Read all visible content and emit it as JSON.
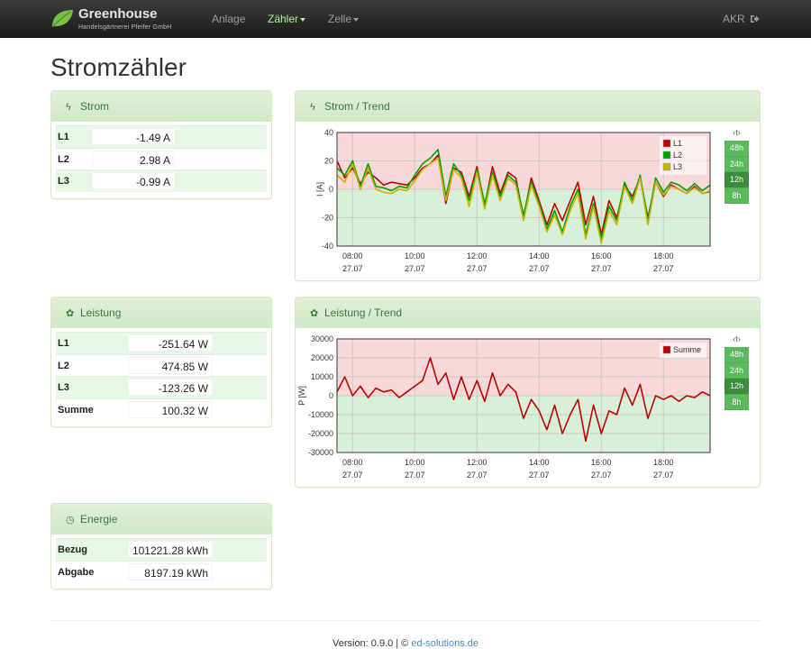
{
  "app": {
    "brand_title": "Greenhouse",
    "brand_subtitle": "Handelsgärtnerei Pfeifer GmbH",
    "brand_icon": "leaf-icon",
    "accent_color": "#5cb85c"
  },
  "nav": {
    "items": [
      {
        "label": "Anlage",
        "active": false
      },
      {
        "label": "Zähler",
        "active": true,
        "dropdown": true
      },
      {
        "label": "Zelle",
        "active": false,
        "dropdown": true
      }
    ],
    "user": "AKR",
    "logout_icon": "logout-icon"
  },
  "page": {
    "title": "Stromzähler"
  },
  "strom": {
    "title": "Strom",
    "icon": "bolt-icon",
    "rows": [
      {
        "label": "L1",
        "value": "-1.49 A"
      },
      {
        "label": "L2",
        "value": "2.98 A"
      },
      {
        "label": "L3",
        "value": "-0.99 A"
      }
    ]
  },
  "leistung": {
    "title": "Leistung",
    "icon": "gear-icon",
    "rows": [
      {
        "label": "L1",
        "value": "-251.64 W"
      },
      {
        "label": "L2",
        "value": "474.85 W"
      },
      {
        "label": "L3",
        "value": "-123.26 W"
      },
      {
        "label": "Summe",
        "value": "100.32 W"
      }
    ]
  },
  "energie": {
    "title": "Energie",
    "icon": "clock-icon",
    "rows": [
      {
        "label": "Bezug",
        "value": "101221.28 kWh"
      },
      {
        "label": "Abgabe",
        "value": "8197.19 kWh"
      }
    ]
  },
  "range": {
    "label": "‹t›",
    "options": [
      "48h",
      "24h",
      "12h",
      "8h"
    ],
    "active": "12h"
  },
  "strom_trend": {
    "title": "Strom / Trend",
    "icon": "bolt-icon",
    "chart_data": {
      "type": "line",
      "title": "",
      "ylabel": "I [A]",
      "ylim": [
        -40,
        40
      ],
      "yticks": [
        -40,
        -20,
        0,
        20,
        40
      ],
      "xlim": [
        7.5,
        19.5
      ],
      "xticks": [
        {
          "x": 8,
          "line1": "08:00",
          "line2": "27.07"
        },
        {
          "x": 10,
          "line1": "10:00",
          "line2": "27.07"
        },
        {
          "x": 12,
          "line1": "12:00",
          "line2": "27.07"
        },
        {
          "x": 14,
          "line1": "14:00",
          "line2": "27.07"
        },
        {
          "x": 16,
          "line1": "16:00",
          "line2": "27.07"
        },
        {
          "x": 18,
          "line1": "18:00",
          "line2": "27.07"
        }
      ],
      "positive_band_color": "#f8d8d8",
      "negative_band_color": "#d8f0d8",
      "legend_position": "top-right",
      "x": [
        7.5,
        7.75,
        8,
        8.25,
        8.5,
        8.75,
        9,
        9.25,
        9.5,
        9.75,
        10,
        10.25,
        10.5,
        10.75,
        11,
        11.25,
        11.5,
        11.75,
        12,
        12.25,
        12.5,
        12.75,
        13,
        13.25,
        13.5,
        13.75,
        14,
        14.25,
        14.5,
        14.75,
        15,
        15.25,
        15.5,
        15.75,
        16,
        16.25,
        16.5,
        16.75,
        17,
        17.25,
        17.5,
        17.75,
        18,
        18.25,
        18.5,
        18.75,
        19,
        19.25,
        19.5
      ],
      "series": [
        {
          "name": "L1",
          "color": "#c00000",
          "values": [
            20,
            8,
            15,
            4,
            12,
            8,
            3,
            5,
            4,
            3,
            8,
            15,
            18,
            24,
            -10,
            15,
            12,
            -5,
            16,
            -12,
            16,
            -3,
            12,
            8,
            -20,
            8,
            -8,
            -25,
            -10,
            -22,
            -8,
            5,
            -25,
            -5,
            -32,
            -8,
            -20,
            3,
            -5,
            8,
            -20,
            5,
            -5,
            3,
            0,
            -3,
            2,
            -3,
            -1.5
          ]
        },
        {
          "name": "L2",
          "color": "#00a000",
          "values": [
            15,
            10,
            20,
            2,
            18,
            2,
            1,
            -1,
            2,
            1,
            10,
            18,
            22,
            28,
            -5,
            18,
            10,
            -8,
            14,
            -10,
            12,
            -5,
            10,
            5,
            -18,
            5,
            -10,
            -28,
            -15,
            -30,
            -12,
            0,
            -32,
            -10,
            -35,
            -12,
            -22,
            5,
            -8,
            10,
            -22,
            8,
            -2,
            5,
            3,
            -1,
            4,
            -1,
            3
          ]
        },
        {
          "name": "L3",
          "color": "#c8b400",
          "values": [
            10,
            5,
            18,
            0,
            15,
            0,
            -2,
            -3,
            0,
            -1,
            6,
            14,
            18,
            22,
            -8,
            14,
            8,
            -12,
            12,
            -14,
            10,
            -8,
            8,
            3,
            -22,
            3,
            -12,
            -30,
            -18,
            -32,
            -15,
            -3,
            -35,
            -12,
            -38,
            -15,
            -25,
            2,
            -10,
            8,
            -25,
            5,
            -4,
            2,
            0,
            -3,
            1,
            -3,
            -1
          ]
        }
      ]
    }
  },
  "leistung_trend": {
    "title": "Leistung / Trend",
    "icon": "gear-icon",
    "chart_data": {
      "type": "line",
      "title": "",
      "ylabel": "P [W]",
      "ylim": [
        -30000,
        30000
      ],
      "yticks": [
        -30000,
        -20000,
        -10000,
        0,
        10000,
        20000,
        30000
      ],
      "xlim": [
        7.5,
        19.5
      ],
      "xticks": [
        {
          "x": 8,
          "line1": "08:00",
          "line2": "27.07"
        },
        {
          "x": 10,
          "line1": "10:00",
          "line2": "27.07"
        },
        {
          "x": 12,
          "line1": "12:00",
          "line2": "27.07"
        },
        {
          "x": 14,
          "line1": "14:00",
          "line2": "27.07"
        },
        {
          "x": 16,
          "line1": "16:00",
          "line2": "27.07"
        },
        {
          "x": 18,
          "line1": "18:00",
          "line2": "27.07"
        }
      ],
      "positive_band_color": "#f8d8d8",
      "negative_band_color": "#d8f0d8",
      "legend_position": "top-right",
      "x": [
        7.5,
        7.75,
        8,
        8.25,
        8.5,
        8.75,
        9,
        9.25,
        9.5,
        9.75,
        10,
        10.25,
        10.5,
        10.75,
        11,
        11.25,
        11.5,
        11.75,
        12,
        12.25,
        12.5,
        12.75,
        13,
        13.25,
        13.5,
        13.75,
        14,
        14.25,
        14.5,
        14.75,
        15,
        15.25,
        15.5,
        15.75,
        16,
        16.25,
        16.5,
        16.75,
        17,
        17.25,
        17.5,
        17.75,
        18,
        18.25,
        18.5,
        18.75,
        19,
        19.25,
        19.5
      ],
      "series": [
        {
          "name": "Summe",
          "color": "#c00000",
          "values": [
            2000,
            10000,
            0,
            5000,
            -1000,
            4000,
            2000,
            3000,
            -1000,
            2000,
            5000,
            8000,
            20000,
            6000,
            12000,
            -2000,
            10000,
            -2000,
            8000,
            -3000,
            12000,
            0,
            6000,
            2000,
            -12000,
            -2000,
            -8000,
            -18000,
            -5000,
            -20000,
            -10000,
            -2000,
            -24000,
            -5000,
            -20000,
            -8000,
            -10000,
            4000,
            -5000,
            6000,
            -12000,
            0,
            -2000,
            0,
            -3000,
            0,
            -1000,
            2000,
            0
          ]
        }
      ]
    }
  },
  "footer": {
    "version_text": "Version: 0.9.0 | © ",
    "link_text": "ed-solutions.de"
  }
}
